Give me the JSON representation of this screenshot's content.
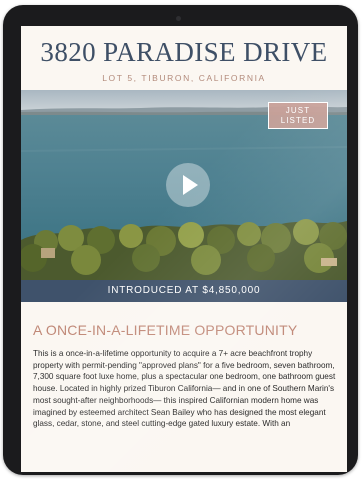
{
  "listing": {
    "title": "3820 PARADISE DRIVE",
    "subtitle": "LOT 5, TIBURON, CALIFORNIA",
    "badge_line1": "JUST",
    "badge_line2": "LISTED",
    "price_banner": "INTRODUCED AT $4,850,000",
    "section_heading": "A ONCE-IN-A-LIFETIME OPPORTUNITY",
    "description": "This is a once-in-a-lifetime opportunity to acquire a 7+ acre beachfront trophy property with permit-pending \"approved plans\" for a five bedroom, seven bathroom, 7,300 square foot luxe home, plus a spectacular one bedroom, one bathroom guest house. Located in highly prized Tiburon California— and in one of Southern Marin's most sought-after neighborhoods— this inspired Californian modern home was imagined by esteemed architect Sean Bailey who has designed the most elegant glass, cedar, stone, and steel cutting-edge gated luxury estate. With an"
  },
  "icons": {
    "play": "play-icon"
  },
  "colors": {
    "title": "#3e4f66",
    "subtitle": "#b38b7c",
    "banner": "#3f526b",
    "badge": "#c9a098",
    "heading": "#c08877"
  }
}
